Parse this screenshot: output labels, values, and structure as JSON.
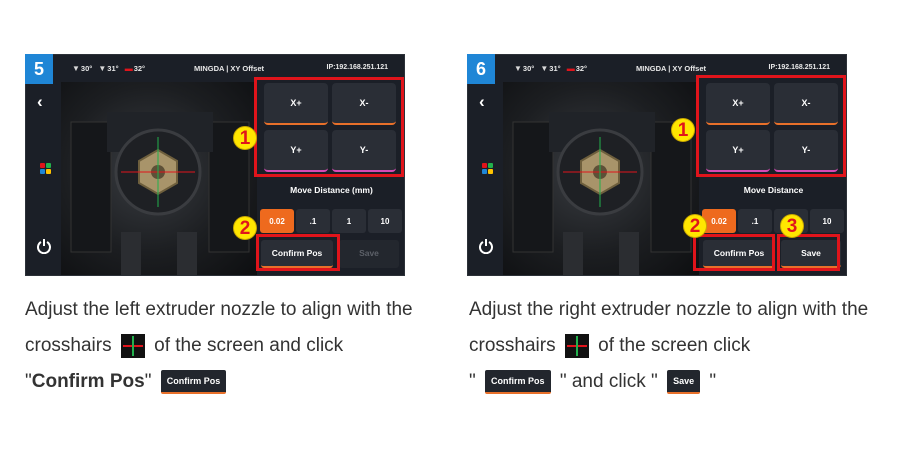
{
  "steps": [
    {
      "number": "5",
      "status": {
        "temp1": "30°",
        "temp2": "31°",
        "temp3": "32°",
        "title": "MINGDA | XY Offset",
        "ip": "IP:192.168.251.121"
      },
      "jog": {
        "x_plus": "X+",
        "x_minus": "X-",
        "y_plus": "Y+",
        "y_minus": "Y-"
      },
      "move_distance_label": "Move Distance (mm)",
      "distances": [
        "0.02",
        ".1",
        "1",
        "10"
      ],
      "selected_distance": "0.02",
      "confirm_label": "Confirm Pos",
      "save_label": "Save",
      "save_enabled": false,
      "callouts": [
        "1",
        "2"
      ]
    },
    {
      "number": "6",
      "status": {
        "temp1": "30°",
        "temp2": "31°",
        "temp3": "32°",
        "title": "MINGDA | XY Offset",
        "ip": "IP:192.168.251.121"
      },
      "jog": {
        "x_plus": "X+",
        "x_minus": "X-",
        "y_plus": "Y+",
        "y_minus": "Y-"
      },
      "move_distance_label": "Move Distance",
      "distances": [
        "0.02",
        ".1",
        "1",
        "10"
      ],
      "selected_distance": "0.02",
      "confirm_label": "Confirm Pos",
      "save_label": "Save",
      "save_enabled": true,
      "callouts": [
        "1",
        "2",
        "3"
      ]
    }
  ],
  "captions": {
    "left": {
      "part1": "Adjust the left extruder nozzle to align with the crosshairs",
      "part2": "of the screen and click",
      "quote_open": "\"",
      "bold": "Confirm Pos",
      "quote_close": "\"",
      "button": "Confirm Pos"
    },
    "right": {
      "part1": "Adjust the right extruder nozzle to align with the crosshairs",
      "part2": "of the screen click",
      "quote1_open": "\"",
      "button1": "Confirm Pos",
      "quote1_close": "\" and click \"",
      "button2": "Save",
      "quote2_close": "\""
    }
  },
  "colors": {
    "accent_orange": "#ee6a1e",
    "highlight_red": "#e0141b",
    "callout_yellow": "#ffe600",
    "badge_blue": "#1f86d6",
    "screen_bg": "#1b1f27"
  },
  "icons": [
    "back-chevron-icon",
    "apps-icon",
    "power-icon",
    "extruder-temp-icon",
    "bed-temp-icon"
  ]
}
